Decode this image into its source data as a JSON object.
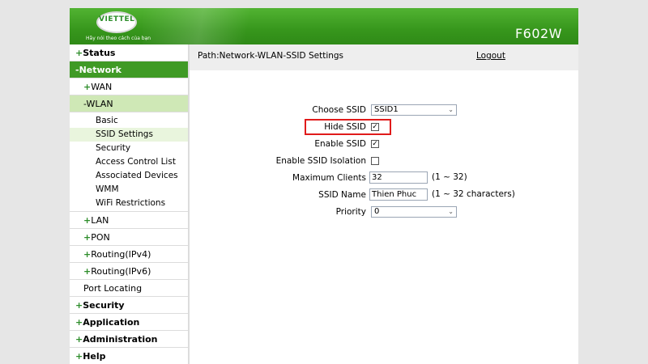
{
  "header": {
    "logo_text": "VIETTEL",
    "slogan": "Hãy nói theo cách của bạn",
    "model": "F602W"
  },
  "sidebar": {
    "status": "Status",
    "network": "Network",
    "wan": "WAN",
    "wlan": "WLAN",
    "wlan_items": [
      "Basic",
      "SSID Settings",
      "Security",
      "Access Control List",
      "Associated Devices",
      "WMM",
      "WiFi Restrictions"
    ],
    "lan": "LAN",
    "pon": "PON",
    "routing_v4": "Routing(IPv4)",
    "routing_v6": "Routing(IPv6)",
    "port_locating": "Port Locating",
    "security": "Security",
    "application": "Application",
    "administration": "Administration",
    "help": "Help",
    "plus": "+",
    "minus": "-"
  },
  "path": {
    "text": "Path:Network-WLAN-SSID Settings",
    "logout": "Logout"
  },
  "form": {
    "choose_ssid_label": "Choose SSID",
    "choose_ssid_value": "SSID1",
    "hide_ssid_label": "Hide SSID",
    "hide_ssid_checked": "✓",
    "enable_ssid_label": "Enable SSID",
    "enable_ssid_checked": "✓",
    "enable_isolation_label": "Enable SSID Isolation",
    "max_clients_label": "Maximum Clients",
    "max_clients_value": "32",
    "max_clients_hint": "(1 ~ 32)",
    "ssid_name_label": "SSID Name",
    "ssid_name_value": "Thien Phuc",
    "ssid_name_hint": "(1 ~ 32 characters)",
    "priority_label": "Priority",
    "priority_value": "0",
    "chevron": "⌄"
  },
  "colors": {
    "brand_green": "#3f9a25",
    "highlight_red": "#e01b1b"
  }
}
